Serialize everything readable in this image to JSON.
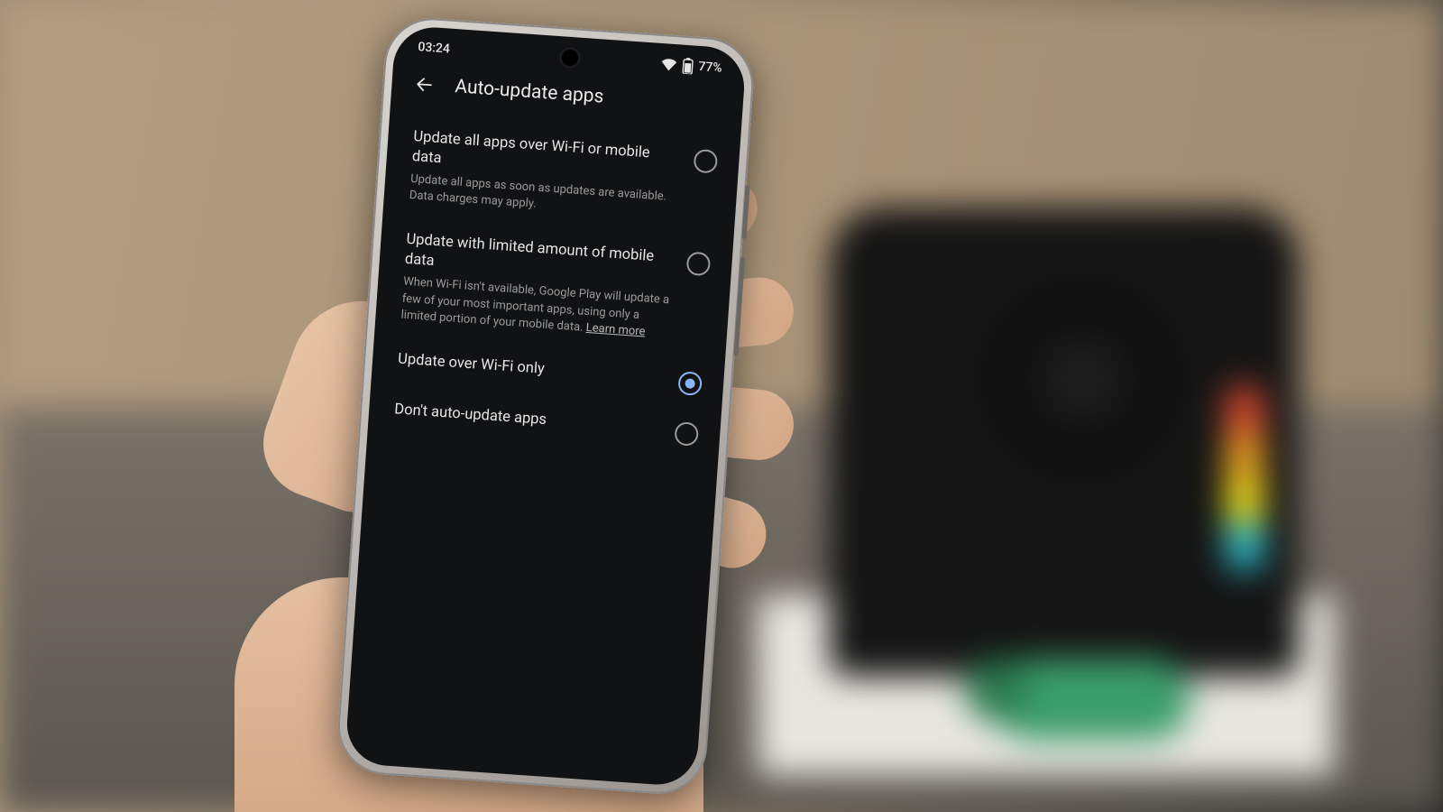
{
  "status": {
    "time": "03:24",
    "battery": "77%"
  },
  "header": {
    "title": "Auto-update apps"
  },
  "options": [
    {
      "title": "Update all apps over Wi-Fi or mobile data",
      "desc": "Update all apps as soon as updates are available. Data charges may apply.",
      "selected": false,
      "learn_more": ""
    },
    {
      "title": "Update with limited amount of mobile data",
      "desc": "When Wi-Fi isn't available, Google Play will update a few of your most important apps, using only a limited portion of your mobile data. ",
      "selected": false,
      "learn_more": "Learn more"
    },
    {
      "title": "Update over Wi-Fi only",
      "desc": "",
      "selected": true,
      "learn_more": ""
    },
    {
      "title": "Don't auto-update apps",
      "desc": "",
      "selected": false,
      "learn_more": ""
    }
  ]
}
